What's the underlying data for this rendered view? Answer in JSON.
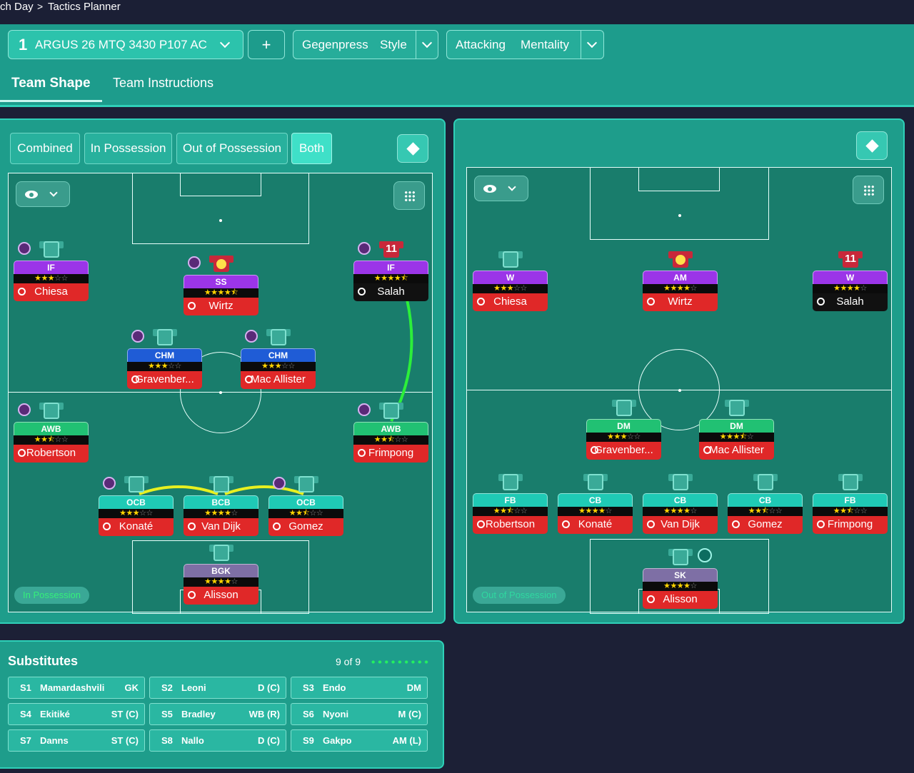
{
  "breadcrumb": {
    "part1": "ch Day",
    "part2": "Tactics Planner"
  },
  "tactic": {
    "number": "1",
    "name": "ARGUS 26 MTQ 3430 P107 AC"
  },
  "style": {
    "w1": "Gegenpress",
    "w2": "Style"
  },
  "mentality": {
    "w1": "Attacking",
    "w2": "Mentality"
  },
  "tabs": {
    "active": "Team Shape",
    "inactive": "Team Instructions"
  },
  "segments": [
    "Combined",
    "In Possession",
    "Out of Possession",
    "Both"
  ],
  "phase": {
    "left": "In Possession",
    "right": "Out of Possession"
  },
  "colors": {
    "accent": "#1e9d8b",
    "highlight": "#2fd0b8",
    "background": "#1c2036"
  },
  "left_players": [
    {
      "role": "IF",
      "stars": 3,
      "name": "Chiesa",
      "shirt": ""
    },
    {
      "role": "SS",
      "stars": 4.5,
      "name": "Wirtz",
      "shirt": "face"
    },
    {
      "role": "IF",
      "stars": 4.5,
      "name": "Salah",
      "shirt": "11"
    },
    {
      "role": "CHM",
      "stars": 3,
      "name": "Gravenber...",
      "shirt": ""
    },
    {
      "role": "CHM",
      "stars": 3,
      "name": "Mac Allister",
      "shirt": ""
    },
    {
      "role": "AWB",
      "stars": 2.5,
      "name": "Robertson",
      "shirt": ""
    },
    {
      "role": "AWB",
      "stars": 2.5,
      "name": "Frimpong",
      "shirt": ""
    },
    {
      "role": "OCB",
      "stars": 3,
      "name": "Konaté",
      "shirt": ""
    },
    {
      "role": "BCB",
      "stars": 4,
      "name": "Van Dijk",
      "shirt": ""
    },
    {
      "role": "OCB",
      "stars": 2.5,
      "name": "Gomez",
      "shirt": ""
    },
    {
      "role": "BGK",
      "stars": 4,
      "name": "Alisson",
      "shirt": ""
    }
  ],
  "right_players": [
    {
      "role": "W",
      "stars": 3,
      "name": "Chiesa",
      "shirt": ""
    },
    {
      "role": "AM",
      "stars": 4,
      "name": "Wirtz",
      "shirt": "face"
    },
    {
      "role": "W",
      "stars": 4,
      "name": "Salah",
      "shirt": "11"
    },
    {
      "role": "DM",
      "stars": 3,
      "name": "Gravenber...",
      "shirt": ""
    },
    {
      "role": "DM",
      "stars": 3.5,
      "name": "Mac Allister",
      "shirt": ""
    },
    {
      "role": "FB",
      "stars": 2.5,
      "name": "Robertson",
      "shirt": ""
    },
    {
      "role": "CB",
      "stars": 4,
      "name": "Konaté",
      "shirt": ""
    },
    {
      "role": "CB",
      "stars": 4,
      "name": "Van Dijk",
      "shirt": ""
    },
    {
      "role": "CB",
      "stars": 2.5,
      "name": "Gomez",
      "shirt": ""
    },
    {
      "role": "FB",
      "stars": 2.5,
      "name": "Frimpong",
      "shirt": ""
    },
    {
      "role": "SK",
      "stars": 4,
      "name": "Alisson",
      "shirt": ""
    }
  ],
  "substitutes": {
    "title": "Substitutes",
    "count": "9 of 9",
    "items": [
      {
        "id": "S1",
        "name": "Mamardashvili",
        "pos": "GK"
      },
      {
        "id": "S2",
        "name": "Leoni",
        "pos": "D (C)"
      },
      {
        "id": "S3",
        "name": "Endo",
        "pos": "DM"
      },
      {
        "id": "S4",
        "name": "Ekitiké",
        "pos": "ST (C)"
      },
      {
        "id": "S5",
        "name": "Bradley",
        "pos": "WB (R)"
      },
      {
        "id": "S6",
        "name": "Nyoni",
        "pos": "M (C)"
      },
      {
        "id": "S7",
        "name": "Danns",
        "pos": "ST (C)"
      },
      {
        "id": "S8",
        "name": "Nallo",
        "pos": "D (C)"
      },
      {
        "id": "S9",
        "name": "Gakpo",
        "pos": "AM (L)"
      }
    ]
  }
}
